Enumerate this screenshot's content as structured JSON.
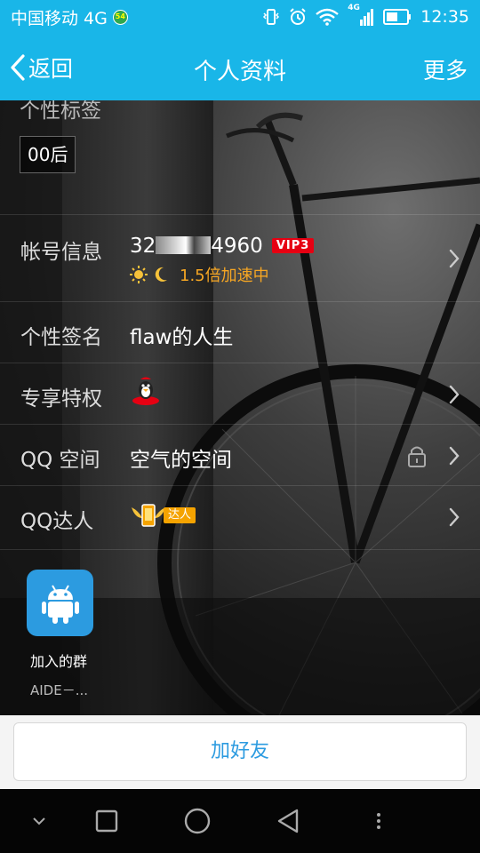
{
  "status_bar": {
    "carrier": "中国移动 4G",
    "carrier_badge": "54",
    "network_label": "4G",
    "time": "12:35"
  },
  "header": {
    "back_label": "返回",
    "title": "个人资料",
    "more_label": "更多"
  },
  "profile": {
    "tag_section_title": "个性标签",
    "tags": [
      "00后"
    ],
    "account": {
      "label": "帐号信息",
      "number_prefix": "32",
      "number_suffix": "4960",
      "vip_badge": "VIP3",
      "speed_text": "1.5倍加速中"
    },
    "signature": {
      "label": "个性签名",
      "value": "flaw的人生"
    },
    "privilege": {
      "label": "专享特权"
    },
    "qzone": {
      "label": "QQ 空间",
      "value": "空气的空间"
    },
    "daren": {
      "label": "QQ达人",
      "badge": "达人"
    },
    "group": {
      "label": "加入的群",
      "subtitle": "AIDE－..."
    }
  },
  "actions": {
    "add_friend": "加好友"
  },
  "colors": {
    "accent": "#19b6e8",
    "vip_red": "#e60012",
    "speed_orange": "#f6a623",
    "link_blue": "#2c9be0"
  }
}
